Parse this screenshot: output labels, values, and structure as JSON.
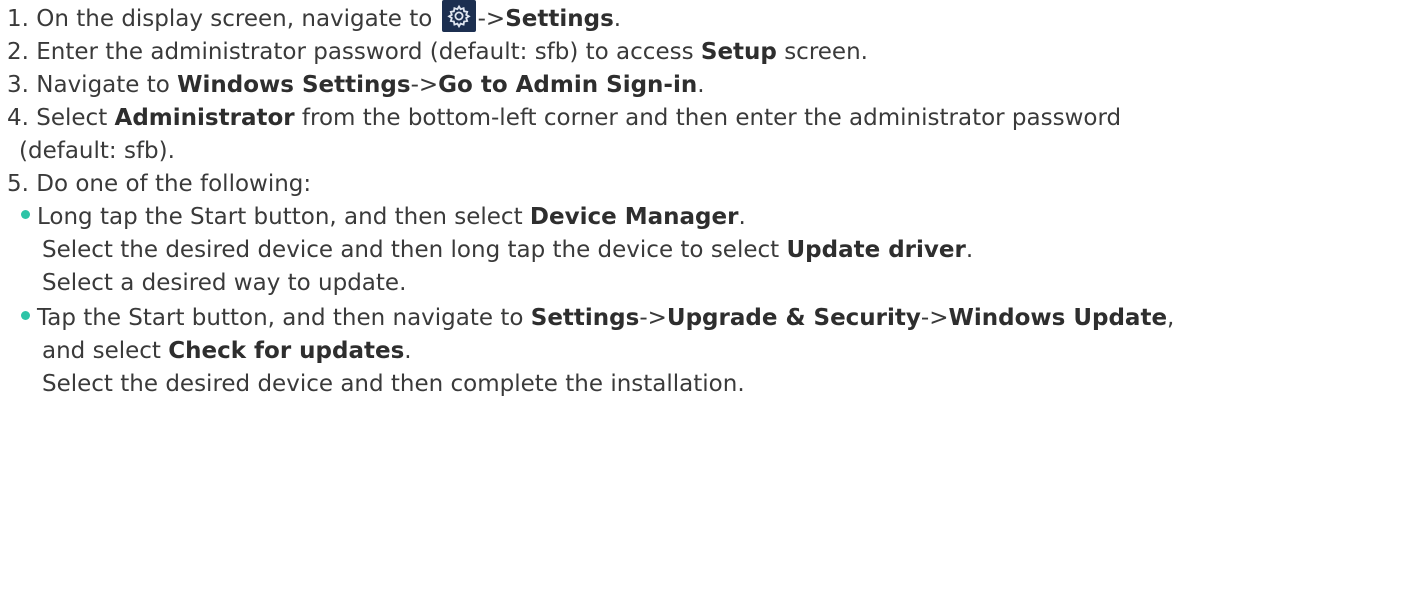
{
  "steps": [
    {
      "num": "1.",
      "t1": "On the display screen, navigate to",
      "icon": "gear-icon",
      "sep": "->",
      "b1": "Settings",
      "end": "."
    },
    {
      "num": "2.",
      "t1": "Enter the administrator password (default: sfb) to access",
      "b1": "Setup",
      "t2": "screen."
    },
    {
      "num": "3.",
      "t1": "Navigate to",
      "b1": "Windows Settings",
      "sep": "->",
      "b2": "Go to Admin Sign-in",
      "end": "."
    },
    {
      "num": "4.",
      "t1": "Select",
      "b1": "Administrator",
      "t2": "from the bottom-left corner and then enter the administrator password",
      "cont": "(default: sfb)."
    },
    {
      "num": "5.",
      "t1": "Do one of the following:"
    }
  ],
  "options": [
    {
      "l1_t1": "Long tap the Start button, and then select",
      "l1_b1": "Device Manager",
      "l1_end": ".",
      "l2_t1": "Select the desired device and then long tap the device to select",
      "l2_b1": "Update driver",
      "l2_end": ".",
      "l3": "Select a desired way to update."
    },
    {
      "l1_t1": "Tap the Start button, and then navigate to",
      "l1_b1": "Settings",
      "sep": "->",
      "l1_b2": "Upgrade & Security",
      "l1_b3": "Windows Update",
      "l1_end": ",",
      "l2_t1": "and select",
      "l2_b1": "Check for updates",
      "l2_end": ".",
      "l3": "Select the desired device and then complete the installation."
    }
  ],
  "colors": {
    "text": "#3a3a3a",
    "bullet": "#2ec4a7",
    "icon_bg": "#1c2f50",
    "icon_fg": "#dfe6f0"
  }
}
